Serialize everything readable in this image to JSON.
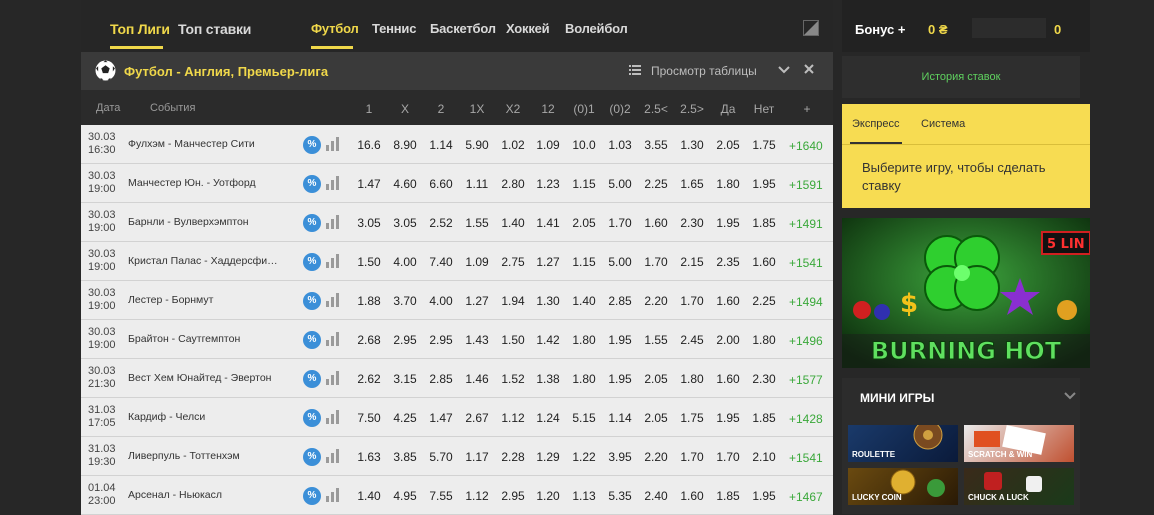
{
  "topnav": {
    "left_tabs": [
      "Топ Лиги",
      "Топ ставки"
    ],
    "sport_tabs": [
      "Футбол",
      "Теннис",
      "Баскетбол",
      "Хоккей",
      "Волейбол"
    ]
  },
  "league": {
    "title": "Футбол - Англия, Премьер-лига",
    "view_table": "Просмотр таблицы"
  },
  "table": {
    "headers": {
      "date": "Дата",
      "events": "События",
      "odds": [
        "1",
        "X",
        "2",
        "1X",
        "X2",
        "12",
        "(0)1",
        "(0)2",
        "2.5<",
        "2.5>",
        "Да",
        "Нет",
        "+"
      ]
    },
    "pct_label": "%",
    "rows": [
      {
        "date": "30.03",
        "time": "16:30",
        "event": "Фулхэм - Манчестер Сити",
        "odds": [
          "16.6",
          "8.90",
          "1.14",
          "5.90",
          "1.02",
          "1.09",
          "10.0",
          "1.03",
          "3.55",
          "1.30",
          "2.05",
          "1.75"
        ],
        "more": "+1640"
      },
      {
        "date": "30.03",
        "time": "19:00",
        "event": "Манчестер Юн. - Уотфорд",
        "odds": [
          "1.47",
          "4.60",
          "6.60",
          "1.11",
          "2.80",
          "1.23",
          "1.15",
          "5.00",
          "2.25",
          "1.65",
          "1.80",
          "1.95"
        ],
        "more": "+1591"
      },
      {
        "date": "30.03",
        "time": "19:00",
        "event": "Барнли - Вулверхэмптон",
        "odds": [
          "3.05",
          "3.05",
          "2.52",
          "1.55",
          "1.40",
          "1.41",
          "2.05",
          "1.70",
          "1.60",
          "2.30",
          "1.95",
          "1.85"
        ],
        "more": "+1491"
      },
      {
        "date": "30.03",
        "time": "19:00",
        "event": "Кристал Палас - Хаддерсфилд Таун",
        "odds": [
          "1.50",
          "4.00",
          "7.40",
          "1.09",
          "2.75",
          "1.27",
          "1.15",
          "5.00",
          "1.70",
          "2.15",
          "2.35",
          "1.60"
        ],
        "more": "+1541"
      },
      {
        "date": "30.03",
        "time": "19:00",
        "event": "Лестер - Борнмут",
        "odds": [
          "1.88",
          "3.70",
          "4.00",
          "1.27",
          "1.94",
          "1.30",
          "1.40",
          "2.85",
          "2.20",
          "1.70",
          "1.60",
          "2.25"
        ],
        "more": "+1494"
      },
      {
        "date": "30.03",
        "time": "19:00",
        "event": "Брайтон - Саутгемптон",
        "odds": [
          "2.68",
          "2.95",
          "2.95",
          "1.43",
          "1.50",
          "1.42",
          "1.80",
          "1.95",
          "1.55",
          "2.45",
          "2.00",
          "1.80"
        ],
        "more": "+1496"
      },
      {
        "date": "30.03",
        "time": "21:30",
        "event": "Вест Хем Юнайтед - Эвертон",
        "odds": [
          "2.62",
          "3.15",
          "2.85",
          "1.46",
          "1.52",
          "1.38",
          "1.80",
          "1.95",
          "2.05",
          "1.80",
          "1.60",
          "2.30"
        ],
        "more": "+1577"
      },
      {
        "date": "31.03",
        "time": "17:05",
        "event": "Кардиф - Челси",
        "odds": [
          "7.50",
          "4.25",
          "1.47",
          "2.67",
          "1.12",
          "1.24",
          "5.15",
          "1.14",
          "2.05",
          "1.75",
          "1.95",
          "1.85"
        ],
        "more": "+1428"
      },
      {
        "date": "31.03",
        "time": "19:30",
        "event": "Ливерпуль - Тоттенхэм",
        "odds": [
          "1.63",
          "3.85",
          "5.70",
          "1.17",
          "2.28",
          "1.29",
          "1.22",
          "3.95",
          "2.20",
          "1.70",
          "1.70",
          "2.10"
        ],
        "more": "+1541"
      },
      {
        "date": "01.04",
        "time": "23:00",
        "event": "Арсенал - Ньюкасл",
        "odds": [
          "1.40",
          "4.95",
          "7.55",
          "1.12",
          "2.95",
          "1.20",
          "1.13",
          "5.35",
          "2.40",
          "1.60",
          "1.85",
          "1.95"
        ],
        "more": "+1467"
      }
    ]
  },
  "sidebar": {
    "bonus_label": "Бонус +",
    "bonus_amount": "0 ₴",
    "bonus_count": "0",
    "history": "История ставок",
    "slip_tabs": [
      "Экспресс",
      "Система"
    ],
    "slip_message": "Выберите игру, чтобы сделать ставку",
    "banner_title": "BURNING HOT",
    "banner_badge": "5 LIN",
    "mini_header": "МИНИ ИГРЫ",
    "mini_games": [
      "ROULETTE",
      "SCRATCH & WIN",
      "LUCKY COIN",
      "CHUCK A LUCK"
    ]
  },
  "colors": {
    "accent": "#f0d84a",
    "positive": "#3aa83a",
    "pct_badge": "#3b8fd8"
  }
}
